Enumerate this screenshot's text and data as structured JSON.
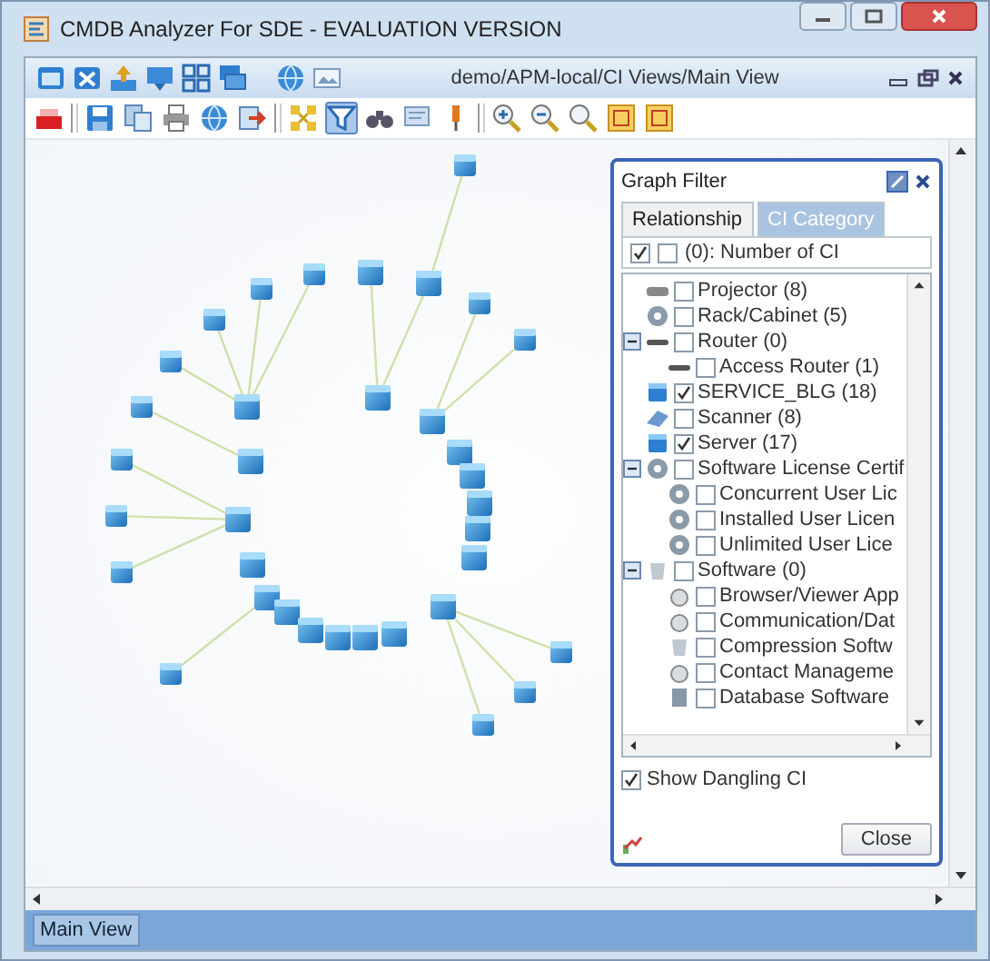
{
  "window": {
    "title": "CMDB Analyzer For SDE - EVALUATION VERSION"
  },
  "view_bar": {
    "path": "demo/APM-local/CI Views/Main View",
    "tools": [
      {
        "kind": "window"
      },
      {
        "kind": "window-x"
      },
      {
        "kind": "upload"
      },
      {
        "kind": "monitor"
      },
      {
        "kind": "grid"
      },
      {
        "kind": "stack"
      },
      {
        "kind": "sep"
      },
      {
        "kind": "globe"
      },
      {
        "kind": "image"
      }
    ]
  },
  "toolbar": [
    {
      "tools": [
        {
          "kind": "eraser",
          "selected": false
        }
      ]
    },
    {
      "tools": [
        {
          "kind": "save",
          "selected": false
        },
        {
          "kind": "copy",
          "selected": false
        },
        {
          "kind": "print",
          "selected": false
        },
        {
          "kind": "globe",
          "selected": false
        },
        {
          "kind": "export",
          "selected": false
        }
      ]
    },
    {
      "tools": [
        {
          "kind": "layout",
          "selected": false
        },
        {
          "kind": "filter",
          "selected": true
        },
        {
          "kind": "binoculars",
          "selected": false
        },
        {
          "kind": "note",
          "selected": false
        },
        {
          "kind": "pin",
          "selected": false
        }
      ]
    },
    {
      "tools": [
        {
          "kind": "zoom-in",
          "selected": false
        },
        {
          "kind": "zoom-out",
          "selected": false
        },
        {
          "kind": "zoom",
          "selected": false
        },
        {
          "kind": "fit",
          "selected": false
        },
        {
          "kind": "fit",
          "selected": false
        }
      ]
    }
  ],
  "graph_filter": {
    "title": "Graph Filter",
    "tabs": [
      {
        "label": "Relationship",
        "selected": false
      },
      {
        "label": "CI Category",
        "selected": true
      }
    ],
    "header": {
      "label": "(0): Number of CI",
      "checked": true
    },
    "tree": [
      {
        "label": "Projector  (8)",
        "kind": "device",
        "checked": false
      },
      {
        "label": "Rack/Cabinet  (5)",
        "kind": "help",
        "checked": false
      },
      {
        "label": "Router  (0)",
        "kind": "router",
        "checked": false,
        "expanded": true,
        "children": [
          {
            "label": "Access Router  (1)",
            "kind": "router",
            "checked": false
          }
        ]
      },
      {
        "label": "SERVICE_BLG  (18)",
        "kind": "server",
        "checked": true
      },
      {
        "label": "Scanner  (8)",
        "kind": "scanner",
        "checked": false
      },
      {
        "label": "Server  (17)",
        "kind": "server",
        "checked": true
      },
      {
        "label": "Software License Certif",
        "kind": "help",
        "checked": false,
        "expanded": true,
        "children": [
          {
            "label": "Concurrent User Lic",
            "kind": "help",
            "checked": false
          },
          {
            "label": "Installed User Licen",
            "kind": "help",
            "checked": false
          },
          {
            "label": "Unlimited User Lice",
            "kind": "help",
            "checked": false
          }
        ]
      },
      {
        "label": "Software  (0)",
        "kind": "software",
        "checked": false,
        "expanded": true,
        "children": [
          {
            "label": "Browser/Viewer App",
            "kind": "disc",
            "checked": false
          },
          {
            "label": "Communication/Dat",
            "kind": "disc",
            "checked": false
          },
          {
            "label": "Compression Softw",
            "kind": "software",
            "checked": false
          },
          {
            "label": "Contact Manageme",
            "kind": "disc",
            "checked": false
          },
          {
            "label": "Database Software",
            "kind": "database",
            "checked": false
          }
        ]
      }
    ],
    "show_dangling": {
      "label": "Show Dangling CI",
      "checked": true
    },
    "close_button": "Close"
  },
  "status_bar": {
    "tab": "Main View"
  }
}
